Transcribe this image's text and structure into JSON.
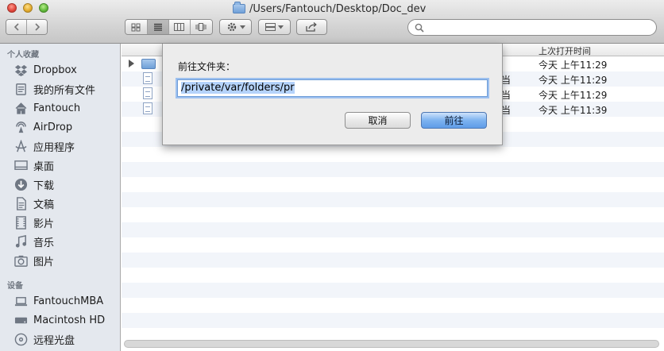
{
  "window": {
    "title": "/Users/Fantouch/Desktop/Doc_dev"
  },
  "toolbar": {
    "back_icon": "chevron-left-icon",
    "forward_icon": "chevron-right-icon",
    "view_modes": [
      "icon-view-icon",
      "list-view-icon",
      "column-view-icon",
      "coverflow-view-icon"
    ],
    "active_view": "list",
    "action_icon": "gear-icon",
    "arrange_icon": "arrange-icon",
    "share_icon": "share-icon",
    "search": {
      "value": "",
      "placeholder": ""
    }
  },
  "sidebar": {
    "favorites_header": "个人收藏",
    "favorites": [
      {
        "label": "Dropbox",
        "icon": "dropbox-icon"
      },
      {
        "label": "我的所有文件",
        "icon": "all-files-icon"
      },
      {
        "label": "Fantouch",
        "icon": "home-icon"
      },
      {
        "label": "AirDrop",
        "icon": "airdrop-icon"
      },
      {
        "label": "应用程序",
        "icon": "applications-icon"
      },
      {
        "label": "桌面",
        "icon": "desktop-icon"
      },
      {
        "label": "下载",
        "icon": "download-icon"
      },
      {
        "label": "文稿",
        "icon": "documents-icon"
      },
      {
        "label": "影片",
        "icon": "movies-icon"
      },
      {
        "label": "音乐",
        "icon": "music-icon"
      },
      {
        "label": "图片",
        "icon": "pictures-icon"
      }
    ],
    "devices_header": "设备",
    "devices": [
      {
        "label": "FantouchMBA",
        "icon": "laptop-icon"
      },
      {
        "label": "Macintosh HD",
        "icon": "hard-drive-icon"
      },
      {
        "label": "远程光盘",
        "icon": "remote-disc-icon"
      }
    ]
  },
  "file_list": {
    "columns": {
      "date_opened": "上次打开时间"
    },
    "rows": [
      {
        "kind": "folder",
        "date_opened": "今天 上午11:29"
      },
      {
        "kind": "document",
        "kind_suffix": "当",
        "date_opened": "今天 上午11:29"
      },
      {
        "kind": "document",
        "kind_suffix": "当",
        "date_opened": "今天 上午11:29"
      },
      {
        "kind": "document",
        "kind_suffix": "当",
        "date_opened": "今天 上午11:39"
      }
    ]
  },
  "go_to_folder_dialog": {
    "label": "前往文件夹：",
    "path_value": "/private/var/folders/pr",
    "cancel_label": "取消",
    "go_label": "前往"
  }
}
